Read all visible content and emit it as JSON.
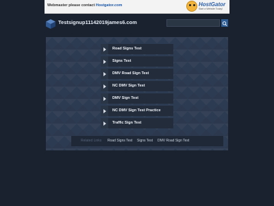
{
  "banner": {
    "message_prefix": "Webmaster please contact ",
    "message_link": "Hostgator.com",
    "brand_name": "HostGator",
    "brand_tagline": "Start a Website Today!"
  },
  "header": {
    "site_title": "Testsignup11142019james6.com",
    "search_placeholder": ""
  },
  "links": [
    {
      "label": "Road Signs Test"
    },
    {
      "label": "Signs Test"
    },
    {
      "label": "DMV Road Sign Test"
    },
    {
      "label": "NC DMV Sign Test"
    },
    {
      "label": "DMV Sign Test"
    },
    {
      "label": "NC DMV Sign Test Practice"
    },
    {
      "label": "Traffic Sign Test"
    }
  ],
  "related": {
    "title": "Related Links",
    "items": [
      {
        "label": "Road Signs Test"
      },
      {
        "label": "Signs Test"
      },
      {
        "label": "DMV Road Sign Test"
      }
    ]
  },
  "colors": {
    "background": "#1a2230",
    "panel": "#2d3b52",
    "accent": "#2e5e96"
  }
}
